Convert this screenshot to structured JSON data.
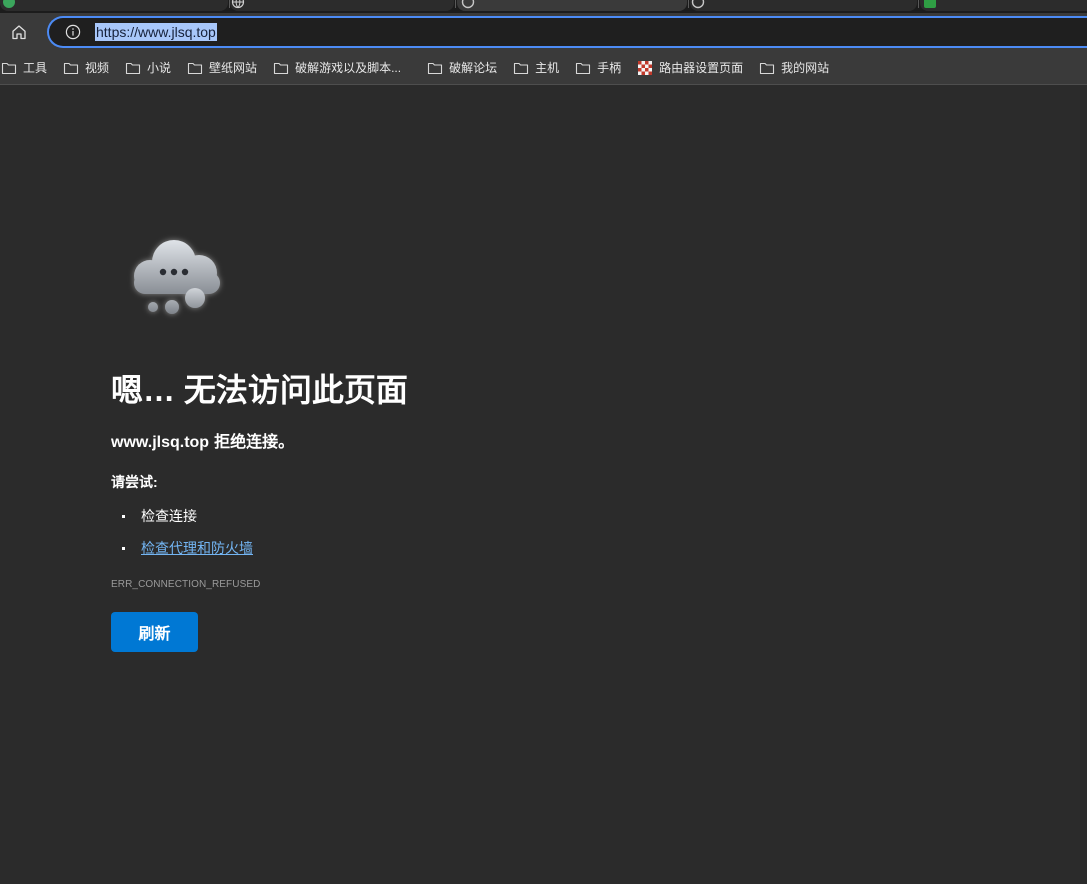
{
  "tabs": [
    {
      "icon": "green-favicon-icon",
      "active": false
    },
    {
      "icon": "globe-icon",
      "active": false
    },
    {
      "icon": "page-icon",
      "active": true
    },
    {
      "icon": "page-icon",
      "active": false
    },
    {
      "icon": "green-favicon-icon",
      "active": false
    }
  ],
  "toolbar": {
    "home_icon": "home-icon",
    "site_info_icon": "info-icon",
    "url": "https://www.jlsq.top"
  },
  "bookmarks": [
    {
      "label": "工具",
      "icon": "folder-icon"
    },
    {
      "label": "视频",
      "icon": "folder-icon"
    },
    {
      "label": "小说",
      "icon": "folder-icon"
    },
    {
      "label": "壁纸网站",
      "icon": "folder-icon"
    },
    {
      "label": "破解游戏以及脚本...",
      "icon": "folder-icon"
    },
    {
      "label": "破解论坛",
      "icon": "folder-icon"
    },
    {
      "label": "主机",
      "icon": "folder-icon"
    },
    {
      "label": "手柄",
      "icon": "folder-icon"
    },
    {
      "label": "路由器设置页面",
      "icon": "router-favicon-icon"
    },
    {
      "label": "我的网站",
      "icon": "folder-icon"
    }
  ],
  "error_page": {
    "illustration_icon": "cloud-icon",
    "heading": "嗯… 无法访问此页面",
    "host": "www.jlsq.top",
    "message": "拒绝连接。",
    "try_label": "请尝试:",
    "suggestions": [
      {
        "text": "检查连接",
        "is_link": false
      },
      {
        "text": "检查代理和防火墙",
        "is_link": true
      }
    ],
    "error_code": "ERR_CONNECTION_REFUSED",
    "reload_label": "刷新"
  },
  "colors": {
    "page_background": "#2b2b2b",
    "toolbar_background": "#3a3a3a",
    "address_focus_ring": "#4c8bf5",
    "url_selection": "#a8c7fa",
    "link": "#73b5f3",
    "accent_button": "#0078d4"
  }
}
